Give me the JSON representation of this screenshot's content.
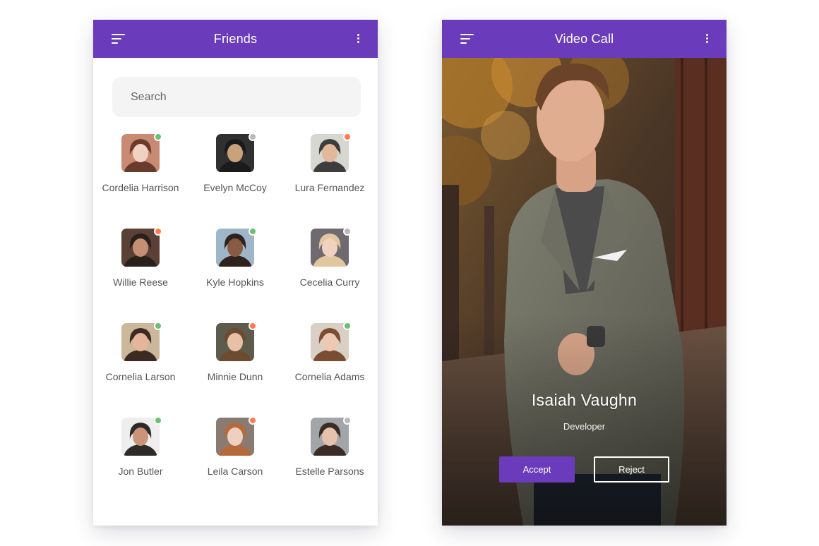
{
  "colors": {
    "accent": "#6a3cbc",
    "online": "#6cc070",
    "busy": "#ff7a50",
    "offline": "#b9b9b9"
  },
  "friends_screen": {
    "title": "Friends",
    "menu_icon": "menu-icon",
    "more_icon": "more-vertical-icon",
    "search": {
      "placeholder": "Search",
      "value": ""
    },
    "friends": [
      {
        "name": "Cordelia Harrison",
        "status": "online"
      },
      {
        "name": "Evelyn McCoy",
        "status": "offline"
      },
      {
        "name": "Lura Fernandez",
        "status": "busy"
      },
      {
        "name": "Willie Reese",
        "status": "busy"
      },
      {
        "name": "Kyle Hopkins",
        "status": "online"
      },
      {
        "name": "Cecelia Curry",
        "status": "offline"
      },
      {
        "name": "Cornelia Larson",
        "status": "online"
      },
      {
        "name": "Minnie Dunn",
        "status": "busy"
      },
      {
        "name": "Cornelia Adams",
        "status": "online"
      },
      {
        "name": "Jon Butler",
        "status": "online"
      },
      {
        "name": "Leila Carson",
        "status": "busy"
      },
      {
        "name": "Estelle Parsons",
        "status": "offline"
      }
    ]
  },
  "video_screen": {
    "title": "Video Call",
    "menu_icon": "menu-icon",
    "more_icon": "more-vertical-icon",
    "caller": {
      "name": "Isaiah Vaughn",
      "role": "Developer"
    },
    "accept_label": "Accept",
    "reject_label": "Reject"
  }
}
